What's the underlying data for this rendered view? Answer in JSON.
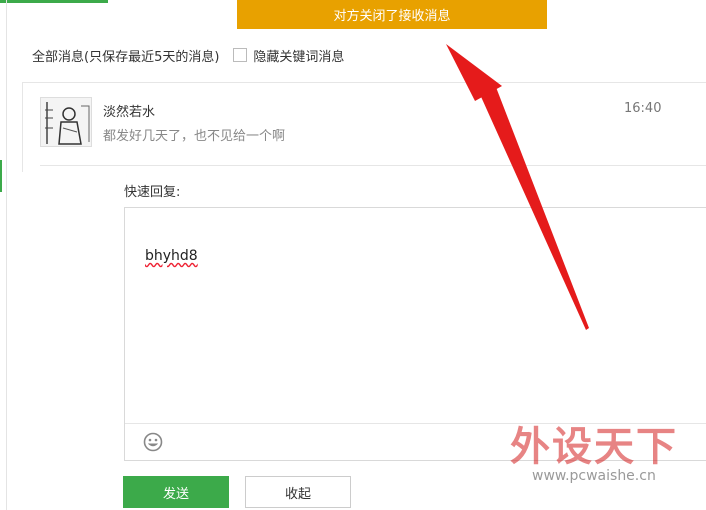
{
  "banner": {
    "text": "对方关闭了接收消息"
  },
  "filter": {
    "all_messages_label": "全部消息(只保存最近5天的消息)",
    "hide_keywords_label": "隐藏关键词消息"
  },
  "message": {
    "sender": "淡然若水",
    "preview": "都发好几天了，也不见给一个啊",
    "time": "16:40"
  },
  "reply": {
    "label": "快速回复:",
    "text": "bhyhd8"
  },
  "buttons": {
    "send_label": "发送",
    "collapse_label": "收起"
  },
  "watermark": {
    "title": "外设天下",
    "url": "www.pcwaishe.cn"
  },
  "icons": {
    "emoji": "smiley-face-icon",
    "arrow": "red-arrow-annotation"
  },
  "colors": {
    "banner_bg": "#e8a100",
    "accent_green": "#3caa4a",
    "arrow_red": "#e51b1b"
  }
}
